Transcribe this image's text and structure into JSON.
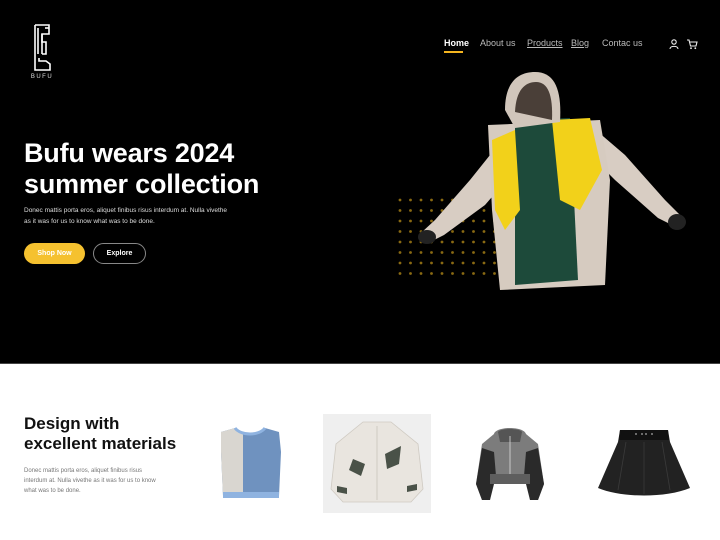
{
  "brand": {
    "logo_text": "BUFU"
  },
  "nav": {
    "items": [
      {
        "label": "Home",
        "active": true
      },
      {
        "label": "About us",
        "active": false
      },
      {
        "label": "Products",
        "active": false
      },
      {
        "label": "Blog",
        "active": false
      },
      {
        "label": "Contac us",
        "active": false
      }
    ],
    "icons": [
      "user-icon",
      "cart-icon"
    ]
  },
  "hero": {
    "headline_line1": "Bufu wears 2024",
    "headline_line2": "summer collection",
    "description": "Donec mattis porta eros, aliquet finibus risus interdum at. Nulla vivethe as it was for us to know what was to be done.",
    "primary_button": "Shop Now",
    "secondary_button": "Explore",
    "accent_color": "#f5c12f"
  },
  "materials": {
    "title_line1": "Design with",
    "title_line2": "excellent materials",
    "description": "Donec mattis porta eros, aliquet finibus risus interdum at. Nulla vivethe as it was for us to know what was to be done.",
    "products": [
      {
        "name": "Denim vest"
      },
      {
        "name": "White patchwork jacket"
      },
      {
        "name": "Grey cropped hooded jacket"
      },
      {
        "name": "Black pleated skirt"
      }
    ]
  }
}
